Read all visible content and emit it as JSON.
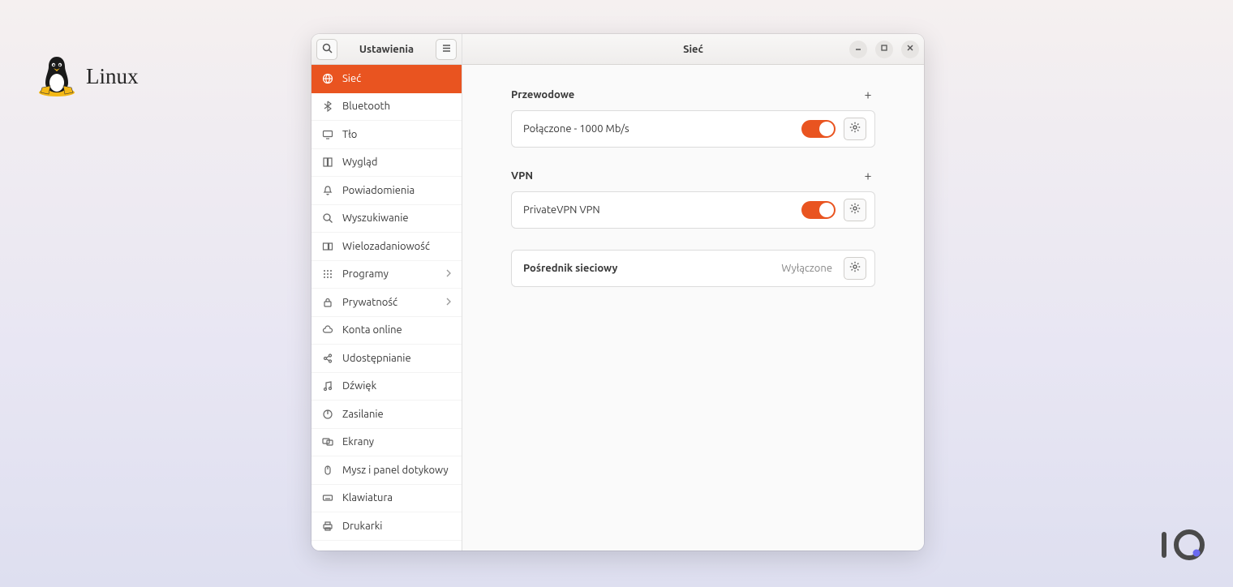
{
  "brand": {
    "label": "Linux"
  },
  "window": {
    "sidebarTitle": "Ustawienia",
    "mainTitle": "Sieć"
  },
  "sidebar": {
    "items": [
      {
        "label": "Sieć",
        "active": true,
        "chevron": false
      },
      {
        "label": "Bluetooth",
        "active": false,
        "chevron": false
      },
      {
        "label": "Tło",
        "active": false,
        "chevron": false
      },
      {
        "label": "Wygląd",
        "active": false,
        "chevron": false
      },
      {
        "label": "Powiadomienia",
        "active": false,
        "chevron": false
      },
      {
        "label": "Wyszukiwanie",
        "active": false,
        "chevron": false
      },
      {
        "label": "Wielozadaniowość",
        "active": false,
        "chevron": false
      },
      {
        "label": "Programy",
        "active": false,
        "chevron": true
      },
      {
        "label": "Prywatność",
        "active": false,
        "chevron": true
      },
      {
        "label": "Konta online",
        "active": false,
        "chevron": false
      },
      {
        "label": "Udostępnianie",
        "active": false,
        "chevron": false
      },
      {
        "label": "Dźwięk",
        "active": false,
        "chevron": false
      },
      {
        "label": "Zasilanie",
        "active": false,
        "chevron": false
      },
      {
        "label": "Ekrany",
        "active": false,
        "chevron": false
      },
      {
        "label": "Mysz i panel dotykowy",
        "active": false,
        "chevron": false
      },
      {
        "label": "Klawiatura",
        "active": false,
        "chevron": false
      },
      {
        "label": "Drukarki",
        "active": false,
        "chevron": false
      }
    ]
  },
  "network": {
    "wired": {
      "header": "Przewodowe",
      "status": "Połączone - 1000 Mb/s",
      "toggleOn": true
    },
    "vpn": {
      "header": "VPN",
      "name": "PrivateVPN VPN",
      "toggleOn": true
    },
    "proxy": {
      "label": "Pośrednik sieciowy",
      "status": "Wyłączone"
    }
  },
  "colors": {
    "accent": "#e95420"
  },
  "icons": {
    "sidebar": [
      "globe-icon",
      "bluetooth-icon",
      "display-icon",
      "appearance-icon",
      "bell-icon",
      "search-icon",
      "multitask-icon",
      "apps-icon",
      "lock-icon",
      "cloud-icon",
      "share-icon",
      "music-icon",
      "power-icon",
      "screens-icon",
      "mouse-icon",
      "keyboard-icon",
      "printer-icon"
    ]
  }
}
